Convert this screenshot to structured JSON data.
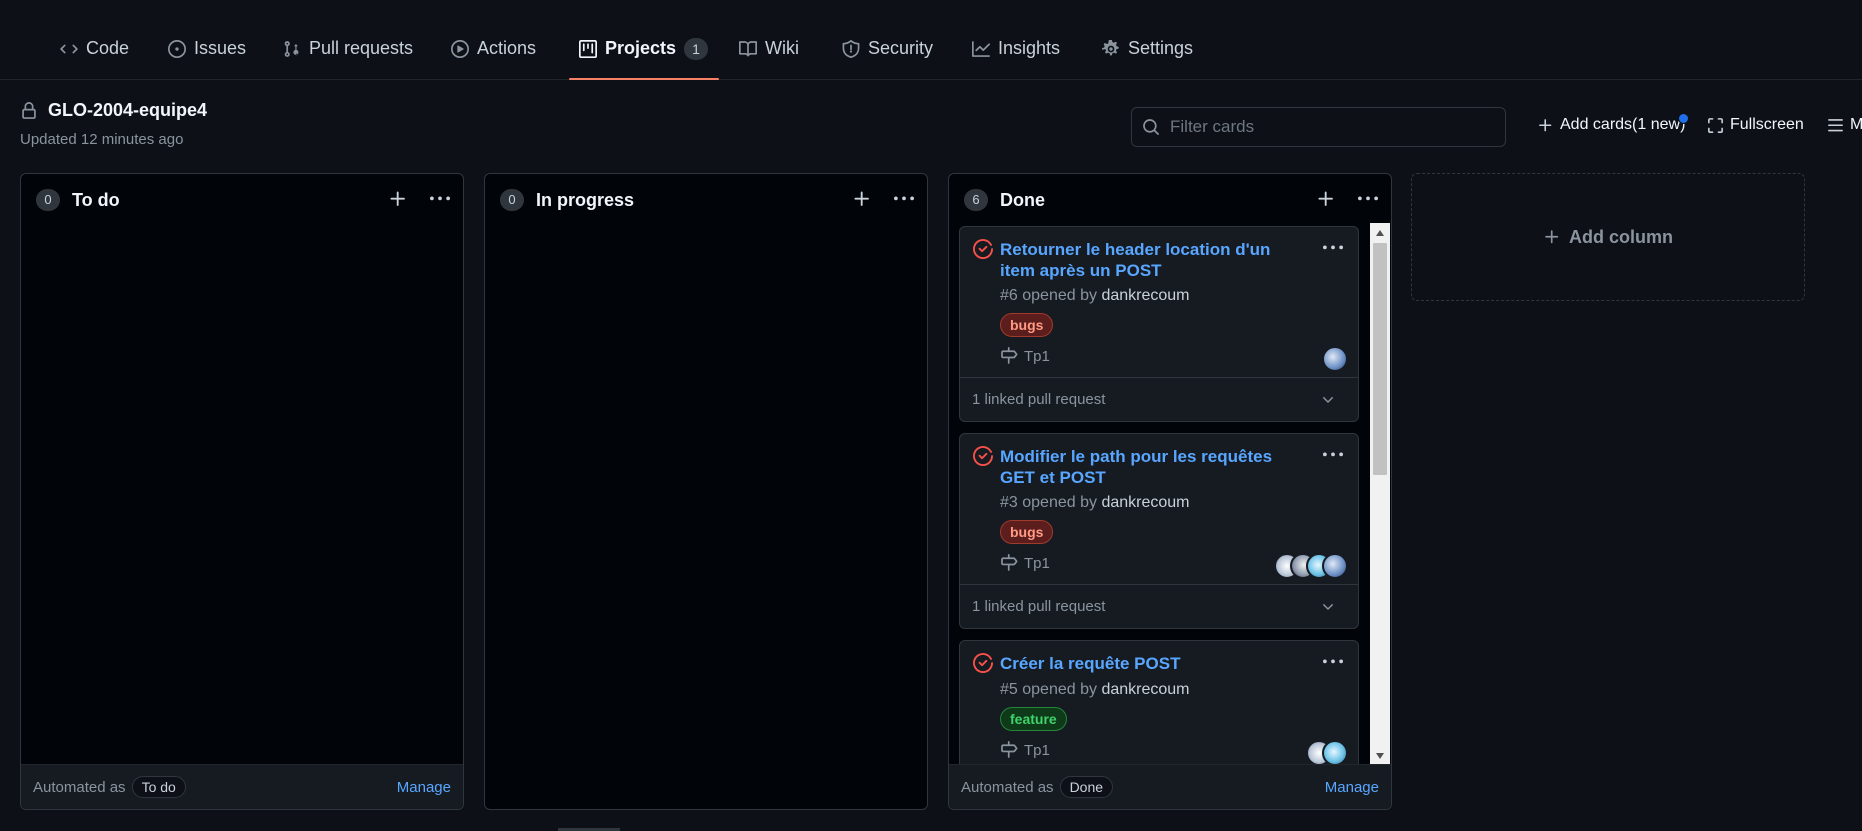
{
  "nav": {
    "items": [
      {
        "label": "Code",
        "icon": "code-icon"
      },
      {
        "label": "Issues",
        "icon": "issue-icon"
      },
      {
        "label": "Pull requests",
        "icon": "pull-request-icon"
      },
      {
        "label": "Actions",
        "icon": "play-icon"
      },
      {
        "label": "Projects",
        "icon": "project-icon",
        "counter": "1",
        "selected": true
      },
      {
        "label": "Wiki",
        "icon": "book-icon"
      },
      {
        "label": "Security",
        "icon": "shield-icon"
      },
      {
        "label": "Insights",
        "icon": "graph-icon"
      },
      {
        "label": "Settings",
        "icon": "gear-icon"
      }
    ]
  },
  "project": {
    "title": "GLO-2004-equipe4",
    "updated": "Updated 12 minutes ago"
  },
  "toolbar": {
    "filter_placeholder": "Filter cards",
    "add_cards": "Add cards(1 new)",
    "fullscreen": "Fullscreen",
    "menu": "M"
  },
  "columns": [
    {
      "count": "0",
      "name": "To do",
      "automated_label": "Automated as",
      "automated_value": "To do",
      "manage": "Manage"
    },
    {
      "count": "0",
      "name": "In progress"
    },
    {
      "count": "6",
      "name": "Done",
      "automated_label": "Automated as",
      "automated_value": "Done",
      "manage": "Manage",
      "cards": [
        {
          "title": "Retourner le header location d'un item après un POST",
          "number": "#6 opened by",
          "author": "dankrecoum",
          "label": "bugs",
          "milestone": "Tp1",
          "linked": "1 linked pull request"
        },
        {
          "title": "Modifier le path pour les requêtes GET et POST",
          "number": "#3 opened by",
          "author": "dankrecoum",
          "label": "bugs",
          "milestone": "Tp1",
          "linked": "1 linked pull request"
        },
        {
          "title": "Créer la requête POST",
          "number": "#5 opened by",
          "author": "dankrecoum",
          "label": "feature",
          "milestone": "Tp1"
        }
      ]
    }
  ],
  "add_column": "Add column",
  "colors": {
    "background": "#0d1117",
    "link": "#58a6ff",
    "selected_tab_underline": "#f78166",
    "issue_closed_icon": "#f85149"
  }
}
